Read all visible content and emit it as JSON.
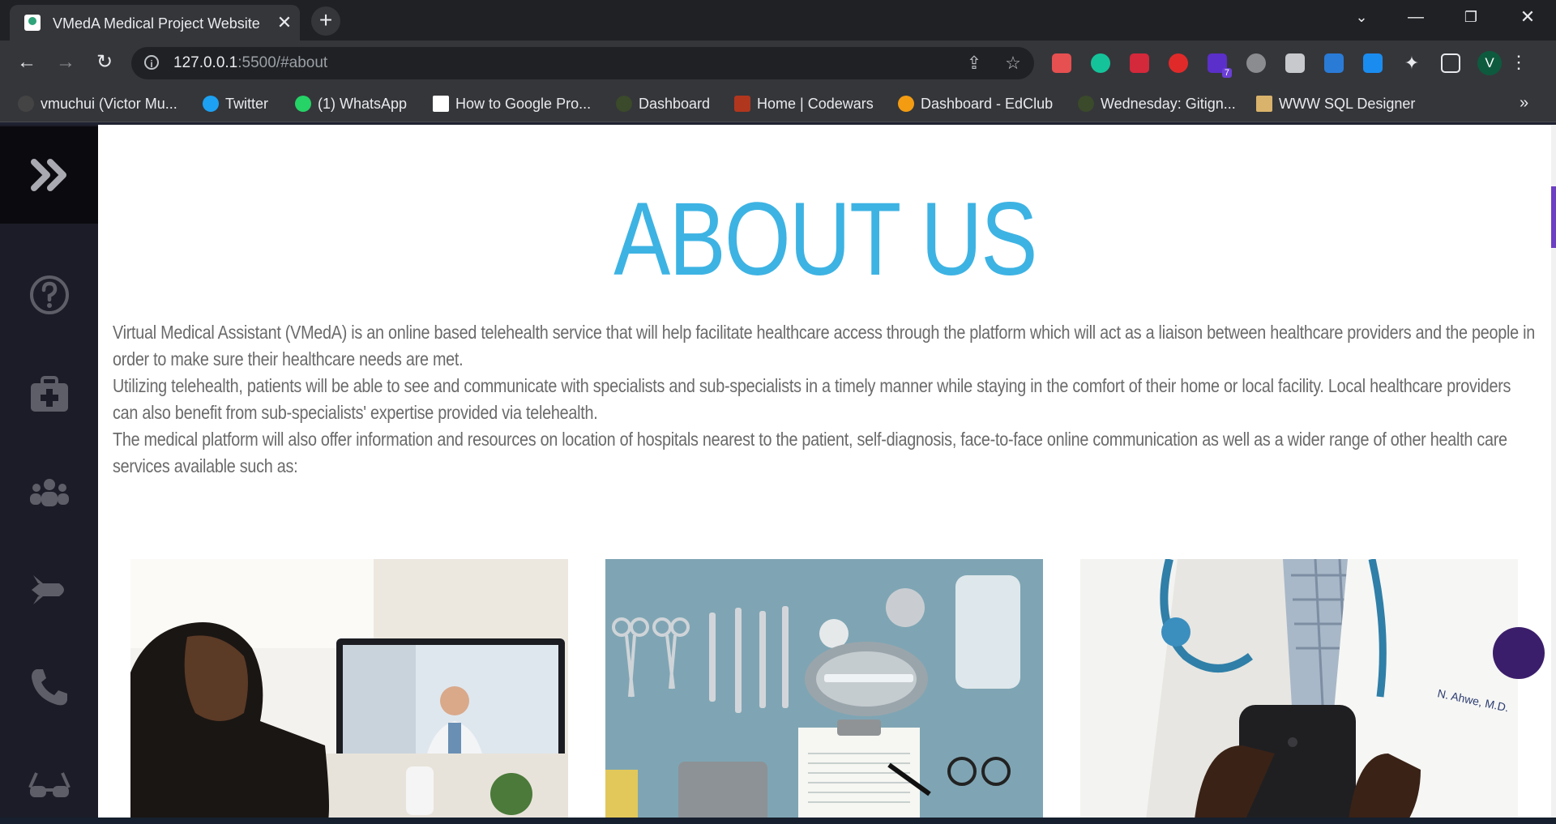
{
  "browser": {
    "tab_title": "VMedA Medical Project Website",
    "new_tab_label": "+",
    "url_host": "127.0.0.1",
    "url_rest": ":5500/#about",
    "profile_initial": "V",
    "extension_badge": "7",
    "bookmarks": [
      "vmuchui (Victor Mu...",
      "Twitter",
      "(1) WhatsApp",
      "How to Google Pro...",
      "Dashboard",
      "Home | Codewars",
      "Dashboard - EdClub",
      "Wednesday: Gitign...",
      "WWW SQL Designer"
    ]
  },
  "sidebar": {
    "items": [
      "expand-icon",
      "help-icon",
      "medical-kit-icon",
      "community-icon",
      "rocket-icon",
      "phone-icon",
      "glasses-icon"
    ]
  },
  "about": {
    "title": "ABOUT US",
    "paragraphs": [
      "Virtual Medical Assistant (VMedA) is an online based telehealth service that will help facilitate healthcare access through the platform which will act as a liaison between healthcare providers and the people in order to make sure their healthcare needs are met.",
      "Utilizing telehealth, patients will be able to see and communicate with specialists and sub-specialists in a timely manner while staying in the comfort of their home or local facility. Local healthcare providers can also benefit from sub-specialists' expertise provided via telehealth.",
      "The medical platform will also offer information and resources on location of hospitals nearest to the patient, self-diagnosis, face-to-face online communication as well as a wider range of other health care services available such as:"
    ]
  },
  "colors": {
    "accent": "#3db3e3",
    "sidebar_bg": "#1c1c28",
    "text": "#6a6a6a"
  }
}
